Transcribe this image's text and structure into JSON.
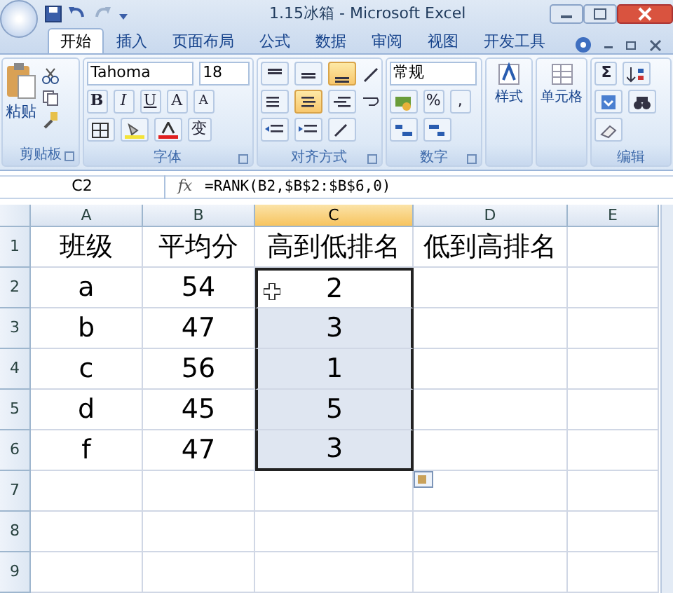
{
  "window": {
    "title": "1.15冰箱 - Microsoft Excel"
  },
  "tabs": [
    {
      "label": "开始",
      "selected": true
    },
    {
      "label": "插入",
      "selected": false
    },
    {
      "label": "页面布局",
      "selected": false
    },
    {
      "label": "公式",
      "selected": false
    },
    {
      "label": "数据",
      "selected": false
    },
    {
      "label": "审阅",
      "selected": false
    },
    {
      "label": "视图",
      "selected": false
    },
    {
      "label": "开发工具",
      "selected": false
    }
  ],
  "ribbon": {
    "clipboard": {
      "label": "剪贴板",
      "paste": "粘贴"
    },
    "font": {
      "label": "字体",
      "name": "Tahoma",
      "size": "18",
      "buttons": [
        "B",
        "I",
        "U",
        "A",
        "A"
      ],
      "phonetic": "变"
    },
    "alignment": {
      "label": "对齐方式",
      "vertical": [
        {
          "selected": false
        },
        {
          "selected": false
        },
        {
          "selected": true
        }
      ],
      "horizontal": [
        {
          "selected": false
        },
        {
          "selected": true
        },
        {
          "selected": false
        }
      ]
    },
    "number": {
      "label": "数字",
      "format": "常规",
      "buttons": [
        "%",
        ","
      ]
    },
    "styles": {
      "button": "样式"
    },
    "cells": {
      "button": "单元格"
    },
    "editing": {
      "label": "编辑",
      "sum": "Σ"
    }
  },
  "formula_bar": {
    "name_box": "C2",
    "function_button": "fx",
    "formula": "=RANK(B2,$B$2:$B$6,0)"
  },
  "sheet": {
    "columns": [
      {
        "label": "A",
        "selected": false
      },
      {
        "label": "B",
        "selected": false
      },
      {
        "label": "C",
        "selected": true
      },
      {
        "label": "D",
        "selected": false
      },
      {
        "label": "E",
        "selected": false
      }
    ],
    "rows": [
      {
        "label": "1",
        "cells": [
          {
            "text": "班级",
            "selected": false,
            "active": false
          },
          {
            "text": "平均分",
            "selected": false,
            "active": false
          },
          {
            "text": "高到低排名",
            "selected": false,
            "active": false
          },
          {
            "text": "低到高排名",
            "selected": false,
            "active": false
          }
        ]
      },
      {
        "label": "2",
        "cells": [
          {
            "text": "a",
            "selected": false,
            "active": false
          },
          {
            "text": "54",
            "selected": false,
            "active": false
          },
          {
            "text": "2",
            "selected": true,
            "active": true
          }
        ]
      },
      {
        "label": "3",
        "cells": [
          {
            "text": "b",
            "selected": false,
            "active": false
          },
          {
            "text": "47",
            "selected": false,
            "active": false
          },
          {
            "text": "3",
            "selected": true,
            "active": false
          }
        ]
      },
      {
        "label": "4",
        "cells": [
          {
            "text": "c",
            "selected": false,
            "active": false
          },
          {
            "text": "56",
            "selected": false,
            "active": false
          },
          {
            "text": "1",
            "selected": true,
            "active": false
          }
        ]
      },
      {
        "label": "5",
        "cells": [
          {
            "text": "d",
            "selected": false,
            "active": false
          },
          {
            "text": "45",
            "selected": false,
            "active": false
          },
          {
            "text": "5",
            "selected": true,
            "active": false
          }
        ]
      },
      {
        "label": "6",
        "cells": [
          {
            "text": "f",
            "selected": false,
            "active": false
          },
          {
            "text": "47",
            "selected": false,
            "active": false
          },
          {
            "text": "3",
            "selected": true,
            "active": false
          }
        ]
      },
      {
        "label": "7",
        "cells": []
      },
      {
        "label": "8",
        "cells": []
      },
      {
        "label": "9",
        "cells": []
      }
    ]
  }
}
